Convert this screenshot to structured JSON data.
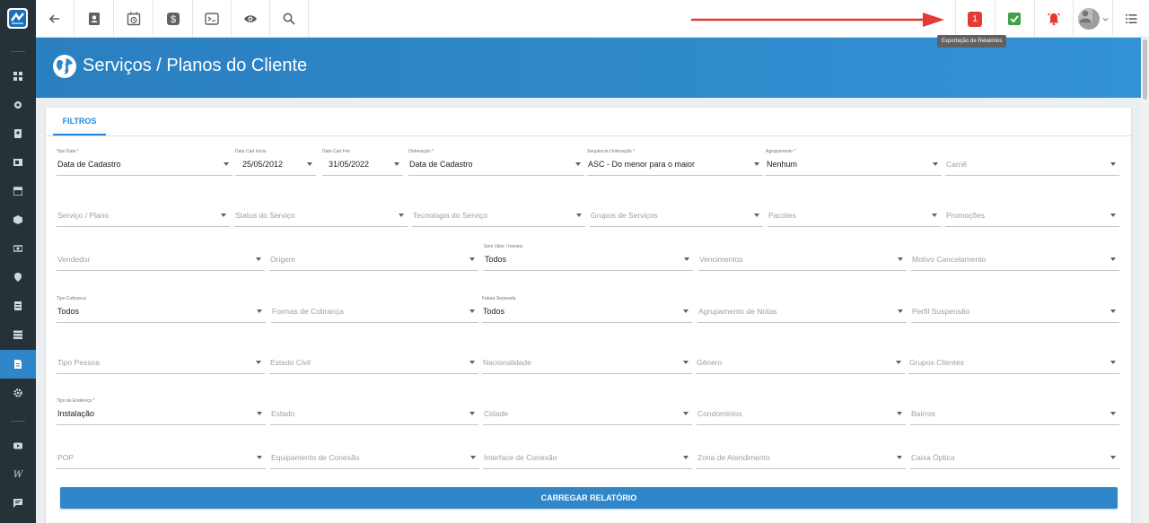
{
  "colors": {
    "brand": "#2f86c8",
    "sidebar": "#263238",
    "alert": "#e53935",
    "success": "#43a047"
  },
  "sidebar": {
    "icons": [
      "dashboard-icon",
      "settings-cog-icon",
      "contact-card-icon",
      "image-icon",
      "calendar-icon",
      "package-icon",
      "money-icon",
      "location-pin-icon",
      "list-icon",
      "layers-icon",
      "document-icon",
      "gear-icon",
      "youtube-icon",
      "wordpress-icon",
      "chat-icon"
    ],
    "wp_glyph": "W"
  },
  "topbar": {
    "icons_left": [
      "back-arrow-icon",
      "contact-book-icon",
      "schedule-icon",
      "dollar-icon",
      "terminal-icon",
      "eye-icon",
      "search-icon"
    ],
    "notification_count": "1",
    "tooltip": "Exportação de Relatórios",
    "icons_right": [
      "report-export-icon",
      "check-icon",
      "alarm-icon",
      "user-avatar-icon",
      "menu-list-icon"
    ]
  },
  "header": {
    "title": "Serviços / Planos do Cliente"
  },
  "tabs": {
    "filtros": "FILTROS"
  },
  "filters": {
    "row1": [
      {
        "label": "Tipo Data *",
        "value": "Data de Cadastro"
      },
      {
        "label": "Data Cad Início",
        "value": "25/05/2012"
      },
      {
        "label": "Data Cad Fim",
        "value": "31/05/2022"
      },
      {
        "label": "Ordenação *",
        "value": "Data de Cadastro"
      },
      {
        "label": "Sequência Ordenação *",
        "value": "ASC - Do menor para o maior"
      },
      {
        "label": "Agrupamento *",
        "value": "Nenhum"
      },
      {
        "label": "",
        "placeholder": "Carnê"
      }
    ],
    "row2": [
      {
        "placeholder": "Serviço / Plano"
      },
      {
        "placeholder": "Status do Serviço"
      },
      {
        "placeholder": "Tecnologia do Serviço"
      },
      {
        "placeholder": "Grupos de Serviços"
      },
      {
        "placeholder": "Pacotes"
      },
      {
        "placeholder": "Promoções"
      }
    ],
    "row3": [
      {
        "placeholder": "Vendedor"
      },
      {
        "placeholder": "Origem"
      },
      {
        "label": "Sem Valor / Isentos",
        "value": "Todos"
      },
      {
        "placeholder": "Vencimentos"
      },
      {
        "placeholder": "Motivo Cancelamento"
      }
    ],
    "row4": [
      {
        "label": "Tipo Cobranca",
        "value": "Todos"
      },
      {
        "placeholder": "Formas de Cobrança"
      },
      {
        "label": "Fatura Separada",
        "value": "Todos"
      },
      {
        "placeholder": "Agrupamento de Notas"
      },
      {
        "placeholder": "Perfil Suspensão"
      }
    ],
    "row5": [
      {
        "placeholder": "Tipo Pessoa"
      },
      {
        "placeholder": "Estado Civil"
      },
      {
        "placeholder": "Nacionalidade"
      },
      {
        "placeholder": "Gênero"
      },
      {
        "placeholder": "Grupos Clientes"
      }
    ],
    "row6": [
      {
        "label": "Tipo de Endereço *",
        "value": "Instalação"
      },
      {
        "placeholder": "Estado"
      },
      {
        "placeholder": "Cidade"
      },
      {
        "placeholder": "Condominios"
      },
      {
        "placeholder": "Bairros"
      }
    ],
    "row7": [
      {
        "placeholder": "POP"
      },
      {
        "placeholder": "Equipamento de Conexão"
      },
      {
        "placeholder": "Interface de Conexão"
      },
      {
        "placeholder": "Zona de Atendimento"
      },
      {
        "placeholder": "Caixa Óptica"
      }
    ]
  },
  "actions": {
    "load_report": "CARREGAR RELATÓRIO"
  }
}
